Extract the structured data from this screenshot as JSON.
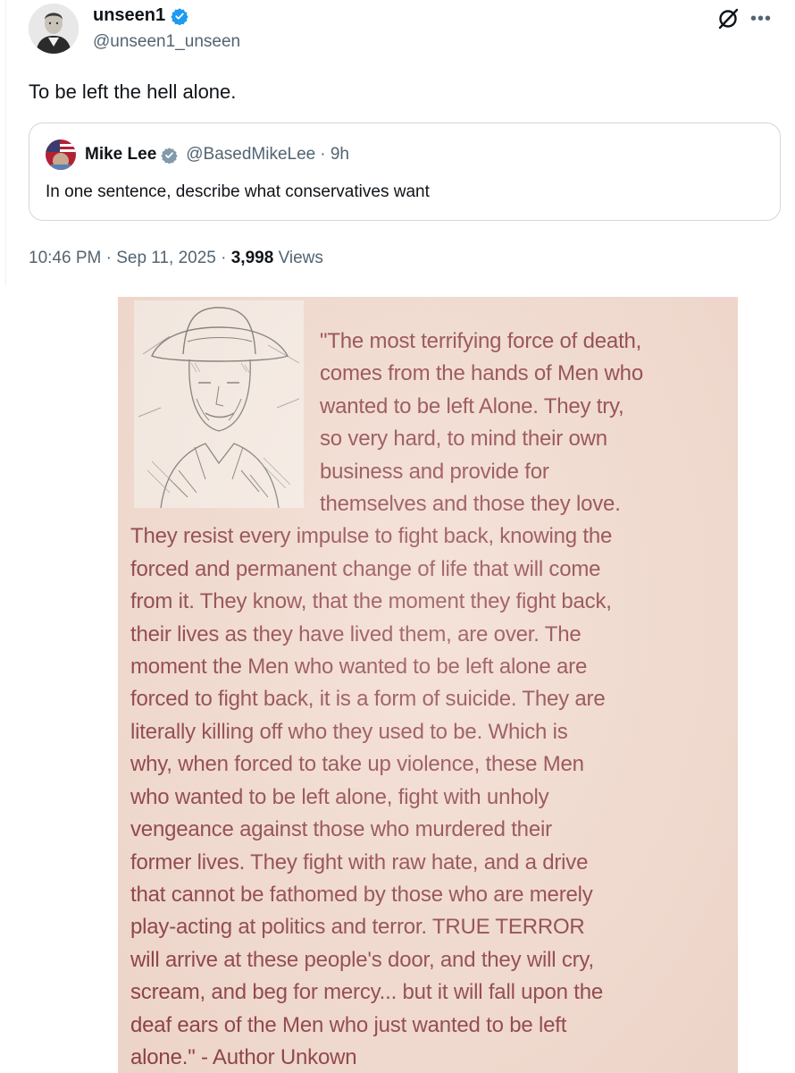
{
  "tweet": {
    "author_name": "unseen1",
    "author_handle": "@unseen1_unseen",
    "text": "To be left the hell alone.",
    "timestamp": "10:46 PM · Sep 11, 2025 · ",
    "views_count": "3,998",
    "views_label": "Views",
    "more_icon": "more-icon",
    "grok_icon": "grok-icon"
  },
  "quoted": {
    "author_name": "Mike Lee",
    "author_handle": "@BasedMikeLee",
    "age": "· 9h",
    "text": "In one sentence, describe what conservatives want"
  },
  "colors": {
    "verified": "#1d9bf0",
    "quote_text": "#7a2630",
    "poster_bg": "#efd8cd"
  },
  "image": {
    "lines_beside": [
      "\"The most terrifying force of death,",
      "comes from the hands of Men who",
      "wanted to be left Alone. They try,",
      "so very hard, to mind their own",
      "business and provide for",
      "themselves and those they love."
    ],
    "lines_full": [
      "They resist every impulse to fight back, knowing the",
      "forced and permanent change of life that will come",
      "from it. They know, that the moment they fight back,",
      "their lives as they have lived them, are over. The",
      "moment the Men who wanted to be left alone are",
      "forced to fight back, it is a form of suicide. They are",
      "literally killing off who they used to be. Which is",
      "why, when forced to take up violence, these Men",
      "who wanted to be left alone, fight with unholy",
      "vengeance against those who murdered their",
      "former lives. They fight with raw hate, and a drive",
      "that cannot be fathomed by those who are merely",
      "play-acting at politics and terror. TRUE TERROR",
      "will arrive at these people's door, and they will cry,",
      "scream, and beg for mercy... but it will fall upon the",
      "deaf ears of the Men who just wanted to be left",
      "alone.\" - Author Unkown"
    ]
  }
}
